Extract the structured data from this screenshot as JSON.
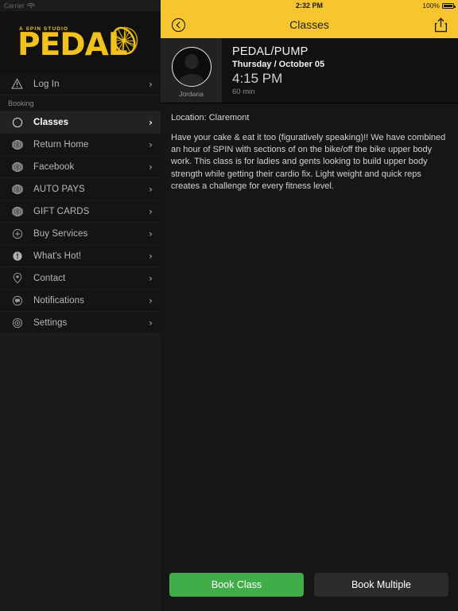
{
  "status_bar": {
    "carrier": "Carrier",
    "wifi_icon": "wifi-icon",
    "time": "2:32 PM",
    "battery_percent": "100%",
    "battery_icon": "battery-full-icon"
  },
  "sidebar": {
    "logo": {
      "tagline": "A SPIN STUDIO",
      "name": "PEDAL",
      "mark": "spin-wheel-icon",
      "color": "#f2c21c"
    },
    "items": [
      {
        "label": "Log In",
        "icon": "warning-triangle-icon",
        "selected": false,
        "chevron": "chevron-right-icon"
      },
      {
        "label": "Classes",
        "icon": "circle-icon",
        "selected": true,
        "chevron": "chevron-right-icon"
      },
      {
        "label": "Return Home",
        "icon": "globe-icon",
        "selected": false,
        "chevron": "chevron-right-icon"
      },
      {
        "label": "Facebook",
        "icon": "globe-icon",
        "selected": false,
        "chevron": "chevron-right-icon"
      },
      {
        "label": "AUTO PAYS",
        "icon": "globe-icon",
        "selected": false,
        "chevron": "chevron-right-icon"
      },
      {
        "label": "GIFT CARDS",
        "icon": "globe-icon",
        "selected": false,
        "chevron": "chevron-right-icon"
      },
      {
        "label": "Buy Services",
        "icon": "plus-circle-icon",
        "selected": false,
        "chevron": "chevron-right-icon"
      },
      {
        "label": "What's Hot!",
        "icon": "exclamation-circle-icon",
        "selected": false,
        "chevron": "chevron-right-icon"
      },
      {
        "label": "Contact",
        "icon": "location-pin-icon",
        "selected": false,
        "chevron": "chevron-right-icon"
      },
      {
        "label": "Notifications",
        "icon": "speech-bubble-icon",
        "selected": false,
        "chevron": "chevron-right-icon"
      },
      {
        "label": "Settings",
        "icon": "gear-icon",
        "selected": false,
        "chevron": "chevron-right-icon"
      }
    ],
    "section_header": "Booking"
  },
  "navbar": {
    "back_icon": "back-circle-chevron-icon",
    "title": "Classes",
    "share_icon": "share-upload-icon",
    "background": "#f7c62e"
  },
  "class": {
    "instructor": "Jordana",
    "avatar_icon": "person-avatar-icon",
    "title": "PEDAL/PUMP",
    "date": "Thursday / October 05",
    "time": "4:15 PM",
    "duration": "60 min",
    "location": "Location: Claremont",
    "description": "Have your cake & eat it too (figuratively speaking)!! We have combined an hour of SPIN with sections of on the bike/off the bike upper body work. This class is for ladies and gents looking to build upper body strength while getting their cardio fix. Light weight and quick reps creates a challenge for every fitness level."
  },
  "footer": {
    "book_class_label": "Book Class",
    "book_multiple_label": "Book Multiple",
    "primary_color": "#41ad49",
    "secondary_color": "#2b2b2b"
  }
}
